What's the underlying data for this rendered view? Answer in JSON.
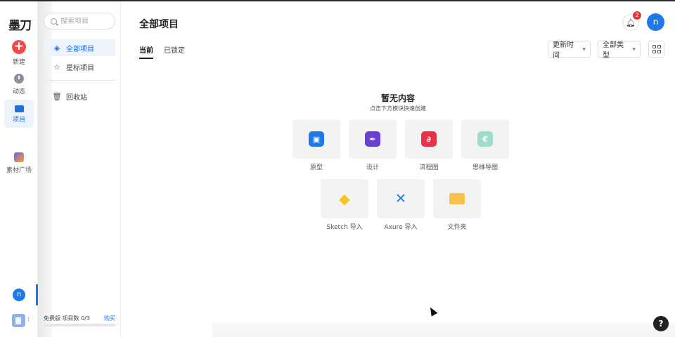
{
  "rail": {
    "logo": "墨刀",
    "new_label": "新建",
    "activity_label": "动态",
    "projects_label": "项目",
    "assets_label": "素材广场",
    "avatar_letter": "n"
  },
  "sidebar": {
    "search_placeholder": "搜索项目",
    "items": [
      {
        "label": "全部项目",
        "icon": "layers-icon"
      },
      {
        "label": "星标项目",
        "icon": "star-icon"
      },
      {
        "label": "回收站",
        "icon": "trash-icon"
      }
    ],
    "plan": {
      "text": "免费版 项目数 0/3",
      "buy": "购买",
      "usage_fraction": 0
    }
  },
  "header": {
    "title": "全部项目",
    "notification_count": "2",
    "avatar_letter": "n"
  },
  "tabs": [
    {
      "label": "当前",
      "active": true
    },
    {
      "label": "已锁定",
      "active": false
    }
  ],
  "filters": {
    "sort": "更新时间",
    "type": "全部类型"
  },
  "empty": {
    "title": "暂无内容",
    "subtitle": "点击下方模块快速创建"
  },
  "modules": [
    {
      "label": "原型",
      "icon": "prototype-icon",
      "color": "#1e78e6"
    },
    {
      "label": "设计",
      "icon": "design-pen-icon",
      "color": "#6a3fd4"
    },
    {
      "label": "流程图",
      "icon": "flowchart-icon",
      "color": "#e8324a"
    },
    {
      "label": "思维导图",
      "icon": "mindmap-icon",
      "color": "#9fdccb"
    },
    {
      "label": "Sketch 导入",
      "icon": "sketch-icon",
      "color": "#f7c325"
    },
    {
      "label": "Axure 导入",
      "icon": "axure-icon",
      "color": "#1e78e6"
    },
    {
      "label": "文件夹",
      "icon": "folder-icon",
      "color": "#f5c348"
    }
  ],
  "help": "?"
}
